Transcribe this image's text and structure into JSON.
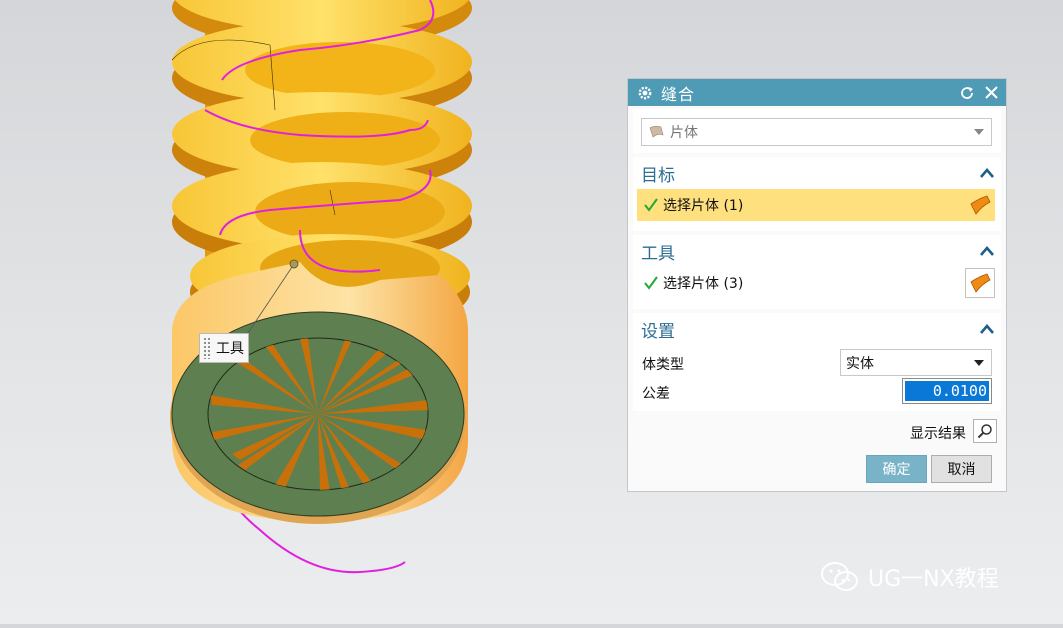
{
  "viewport": {
    "tool_label": "工具"
  },
  "dialog": {
    "title": "缝合",
    "type_select": {
      "value": "片体",
      "icon": "sheet-body-icon"
    },
    "target": {
      "header": "目标",
      "select_label": "选择片体 (1)",
      "icon": "face-select-icon",
      "status": "selected"
    },
    "tool": {
      "header": "工具",
      "select_label": "选择片体 (3)",
      "icon": "face-select-icon",
      "status": "selected"
    },
    "settings": {
      "header": "设置",
      "body_type_label": "体类型",
      "body_type_value": "实体",
      "tolerance_label": "公差",
      "tolerance_value": "0.0100"
    },
    "show_result_label": "显示结果",
    "ok_label": "确定",
    "cancel_label": "取消",
    "colors": {
      "titlebar": "#4f9ab5",
      "active_row": "#fee07f",
      "section_header": "#2d6d93",
      "ok_button": "#79b3c7"
    }
  },
  "watermark": {
    "text": "UG一NX教程",
    "icon": "wechat-icon"
  }
}
